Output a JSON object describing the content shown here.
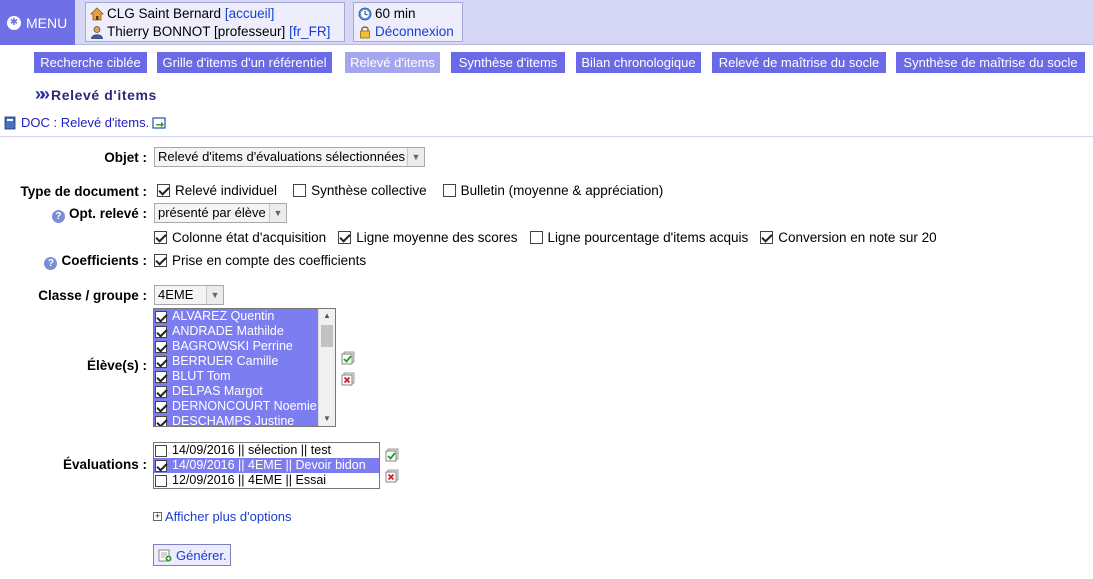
{
  "header": {
    "menu_label": "MENU",
    "establishment": "CLG Saint Bernard",
    "home_link": "[accueil]",
    "user_name": "Thierry BONNOT [professeur]",
    "lang_link": "[fr_FR]",
    "session_time": "60 min",
    "logout_label": "Déconnexion"
  },
  "nav": {
    "buttons": [
      {
        "label": "Recherche ciblée"
      },
      {
        "label": "Grille d'items d'un référentiel"
      },
      {
        "label": "Relevé d'items"
      },
      {
        "label": "Synthèse d'items"
      },
      {
        "label": "Bilan chronologique"
      },
      {
        "label": "Relevé de maîtrise du socle"
      },
      {
        "label": "Synthèse de maîtrise du socle"
      }
    ],
    "active_index": 2
  },
  "page": {
    "title": "Relevé d'items",
    "doc_link": "DOC : Relevé d'items."
  },
  "form": {
    "objet_label": "Objet :",
    "objet_value": "Relevé d'items d'évaluations sélectionnées",
    "type_label": "Type de document :",
    "type_options": [
      {
        "label": "Relevé individuel",
        "checked": true
      },
      {
        "label": "Synthèse collective",
        "checked": false
      },
      {
        "label": "Bulletin (moyenne & appréciation)",
        "checked": false
      }
    ],
    "opt_label": "Opt. relevé :",
    "opt_value": "présenté par élève",
    "opt_options": [
      {
        "label": "Colonne état d'acquisition",
        "checked": true
      },
      {
        "label": "Ligne moyenne des scores",
        "checked": true
      },
      {
        "label": "Ligne pourcentage d'items acquis",
        "checked": false
      },
      {
        "label": "Conversion en note sur 20",
        "checked": true
      }
    ],
    "coef_label": "Coefficients :",
    "coef_option": {
      "label": "Prise en compte des coefficients",
      "checked": true
    },
    "classe_label": "Classe / groupe :",
    "classe_value": "4EME",
    "eleves_label": "Élève(s) :",
    "eleves": [
      {
        "name": "ALVAREZ Quentin",
        "checked": true
      },
      {
        "name": "ANDRADE Mathilde",
        "checked": true
      },
      {
        "name": "BAGROWSKI Perrine",
        "checked": true
      },
      {
        "name": "BERRUER Camille",
        "checked": true
      },
      {
        "name": "BLUT Tom",
        "checked": true
      },
      {
        "name": "DELPAS Margot",
        "checked": true
      },
      {
        "name": "DERNONCOURT Noemie",
        "checked": true
      },
      {
        "name": "DESCHAMPS Justine",
        "checked": true
      }
    ],
    "evaluations_label": "Évaluations :",
    "evaluations": [
      {
        "label": "14/09/2016 || sélection || test",
        "checked": false
      },
      {
        "label": "14/09/2016 || 4EME || Devoir bidon",
        "checked": true
      },
      {
        "label": "12/09/2016 || 4EME || Essai",
        "checked": false
      }
    ],
    "more_options": "Afficher plus d'options",
    "generate_label": "Générer."
  },
  "colors": {
    "accent": "#6a6ae6",
    "accent_light": "#a6a6f0",
    "selection": "#7d7df2",
    "link": "#1a3dd0"
  }
}
